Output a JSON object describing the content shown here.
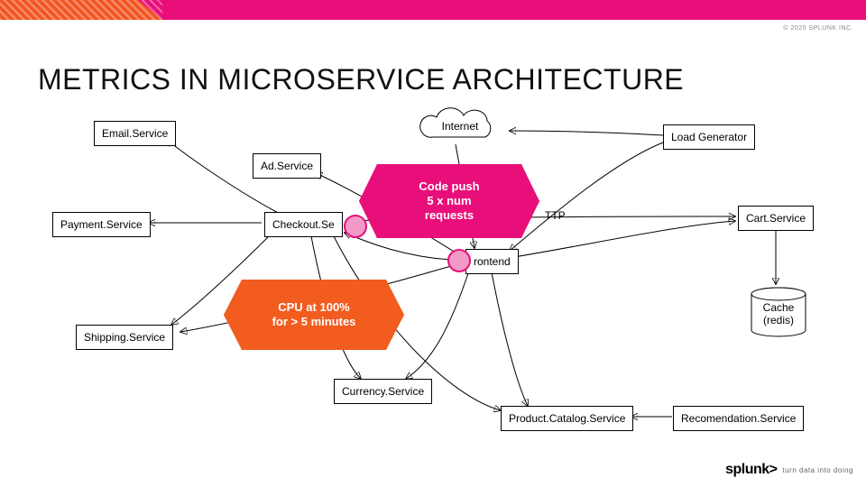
{
  "copyright": "© 2020 SPLUNK INC.",
  "title": "METRICS IN MICROSERVICE ARCHITECTURE",
  "nodes": {
    "email": "Email.Service",
    "ad": "Ad.Service",
    "payment": "Payment.Service",
    "checkout": "Checkout.Service",
    "checkout_truncated": "Checkout.Se",
    "shipping": "Shipping.Service",
    "currency": "Currency.Service",
    "frontend": "Frontend",
    "frontend_truncated": "rontend",
    "loadgen": "Load Generator",
    "cart": "Cart.Service",
    "cache_l1": "Cache",
    "cache_l2": "(redis)",
    "catalog": "Product.Catalog.Service",
    "recommend": "Recomendation.Service",
    "internet": "Internet"
  },
  "labels": {
    "http": "HTTP",
    "http_truncated": "TTP"
  },
  "callouts": {
    "push_l1": "Code push",
    "push_l2": "5 x num",
    "push_l3": "requests",
    "cpu_l1": "CPU at 100%",
    "cpu_l2": "for > 5 minutes"
  },
  "brand": {
    "name": "splunk",
    "gt": ">",
    "tagline": "turn data into doing"
  }
}
